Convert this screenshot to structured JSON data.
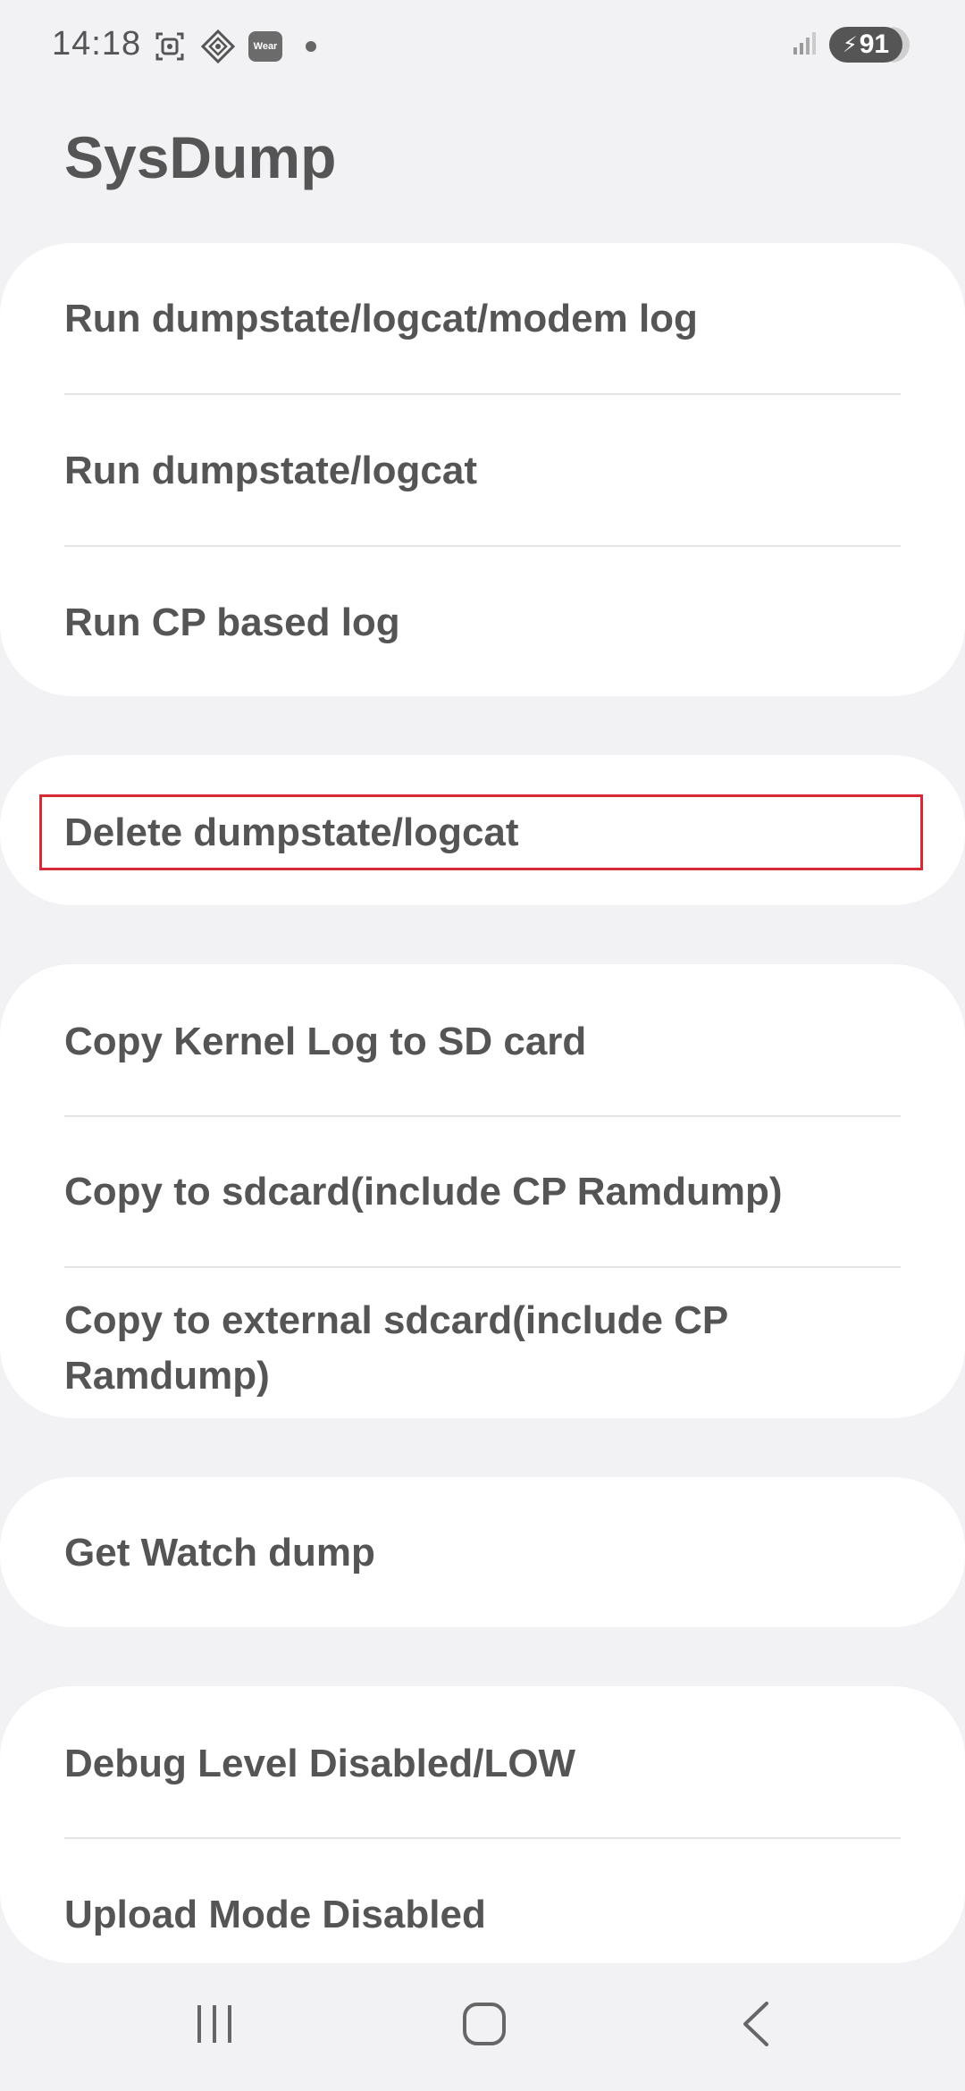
{
  "status_bar": {
    "time": "14:18",
    "battery_level": "91",
    "wear_label": "Wear",
    "icons": [
      "screenshot-icon",
      "diamond-network-icon",
      "wear-badge-icon",
      "notification-dot-icon",
      "signal-icon",
      "battery-charging-icon"
    ]
  },
  "page": {
    "title": "SysDump"
  },
  "groups": [
    {
      "items": [
        {
          "label": "Run dumpstate/logcat/modem log"
        },
        {
          "label": "Run dumpstate/logcat"
        },
        {
          "label": "Run CP based log"
        }
      ]
    },
    {
      "items": [
        {
          "label": "Delete dumpstate/logcat"
        }
      ]
    },
    {
      "items": [
        {
          "label": "Copy Kernel Log to SD card"
        },
        {
          "label": "Copy to sdcard(include CP Ramdump)"
        },
        {
          "label": "Copy to external sdcard(include CP Ramdump)"
        }
      ]
    },
    {
      "items": [
        {
          "label": "Get Watch dump"
        }
      ]
    },
    {
      "items": [
        {
          "label": "Debug Level Disabled/LOW"
        },
        {
          "label": "Upload Mode Disabled"
        }
      ]
    }
  ],
  "nav": {
    "icons": [
      "recents-icon",
      "home-icon",
      "back-icon"
    ]
  },
  "colors": {
    "background": "#f2f2f4",
    "card": "#ffffff",
    "text": "#555555",
    "highlight": "#d42b34"
  }
}
